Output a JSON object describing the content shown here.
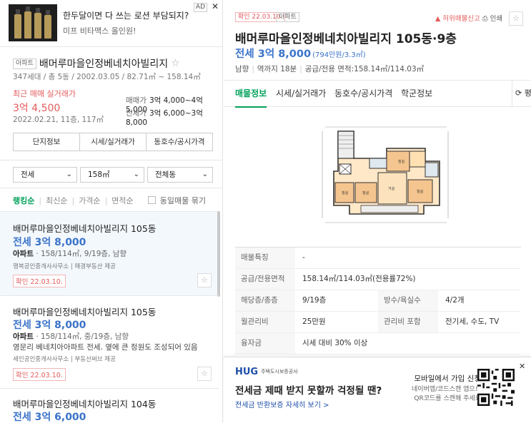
{
  "ad": {
    "title": "한두달이면 다 쓰는 로션 부담되지?",
    "subtitle": "미프 비타맥스 올인원!",
    "badge": "AD",
    "close": "✕"
  },
  "complex": {
    "type_tag": "아파트",
    "name": "배머루마을인정베네치아빌리지",
    "star": "☆",
    "meta": "347세대 / 총 5동 / 2002.03.05 / 82.71㎡ ~ 158.14㎡",
    "recent_label": "최근 매매 실거래가",
    "recent_price": "3억 4,500",
    "recent_date": "2022.02.21, 11층, 117㎡",
    "sale_label": "매매가",
    "sale_range": "3억 4,000~4억 5,000",
    "jeonse_label": "전세가",
    "jeonse_range": "3억 6,000~3억 8,000",
    "buttons": [
      "단지정보",
      "시세/실거래가",
      "동호수/공시가격"
    ]
  },
  "filters": {
    "trade": "전세",
    "area": "158㎡",
    "dong": "전체동"
  },
  "sort": {
    "options": [
      "랭킹순",
      "최신순",
      "가격순",
      "면적순"
    ],
    "active": "랭킹순",
    "group_label": "동일매물 묶기"
  },
  "listings": [
    {
      "title": "배머루마을인정베네치아빌리지 105동",
      "price": "전세 3억 8,000",
      "type": "아파트",
      "info": "· 158/114㎡, 9/19층, 남향",
      "desc": "",
      "agent": "행복공인중개사사무소 | 매경부동산 제공",
      "confirm": "확인 22.03.10."
    },
    {
      "title": "배머루마을인정베네치아빌리지 105동",
      "price": "전세 3억 8,000",
      "type": "아파트",
      "info": "· 158/114㎡, 중/19층, 남향",
      "desc": "영문리 베네치아아파트 전세. 옆에 큰 정원도 조성되어 있음",
      "agent": "세인공인중개사사무소 | 부동산써브 제공",
      "confirm": "확인 22.03.10."
    },
    {
      "title": "배머루마을인정베네치아빌리지 104동",
      "price": "전세 3억 6,000"
    }
  ],
  "detail": {
    "confirm": "확인 22.03.10.",
    "type_tag": "아파트",
    "report": "허위매물신고",
    "print": "인쇄",
    "title": "배머루마을인정베네치아빌리지 105동·9층",
    "price": "전세 3억 8,000",
    "price_won": "(794만원/3.3㎡)",
    "meta": [
      "남향",
      "역까지 18분",
      "공급/전용 면적:158.14㎡/114.03㎡"
    ],
    "tabs": [
      "매물정보",
      "시세/실거래가",
      "동호수/공시가격",
      "학군정보"
    ],
    "refresh": "평",
    "rows": [
      {
        "label": "매물특징",
        "value": "-"
      },
      {
        "label": "공급/전용면적",
        "value": "158.14㎡/114.03㎡(전용률72%)"
      },
      {
        "label": "해당층/총층",
        "value": "9/19층",
        "label2": "방수/욕실수",
        "value2": "4/2개"
      },
      {
        "label": "월관리비",
        "value": "25만원",
        "label2": "관리비 포함",
        "value2": "전기세, 수도, TV"
      },
      {
        "label": "융자금",
        "value": "시세 대비 30% 이상"
      }
    ]
  },
  "banner": {
    "logo": "HUG",
    "logo_sub": "주택도시보증공사",
    "title": "전세금 제때 받지 못할까 걱정될 땐?",
    "link": "전세금 반환보증 자세히 보기 >",
    "right_title": "모바일에서 가입 신청",
    "right_sub1": "네이버앱/코드스캔 앱으로",
    "right_sub2": "QR코드를 스캔해 주세요",
    "close": "✕"
  }
}
